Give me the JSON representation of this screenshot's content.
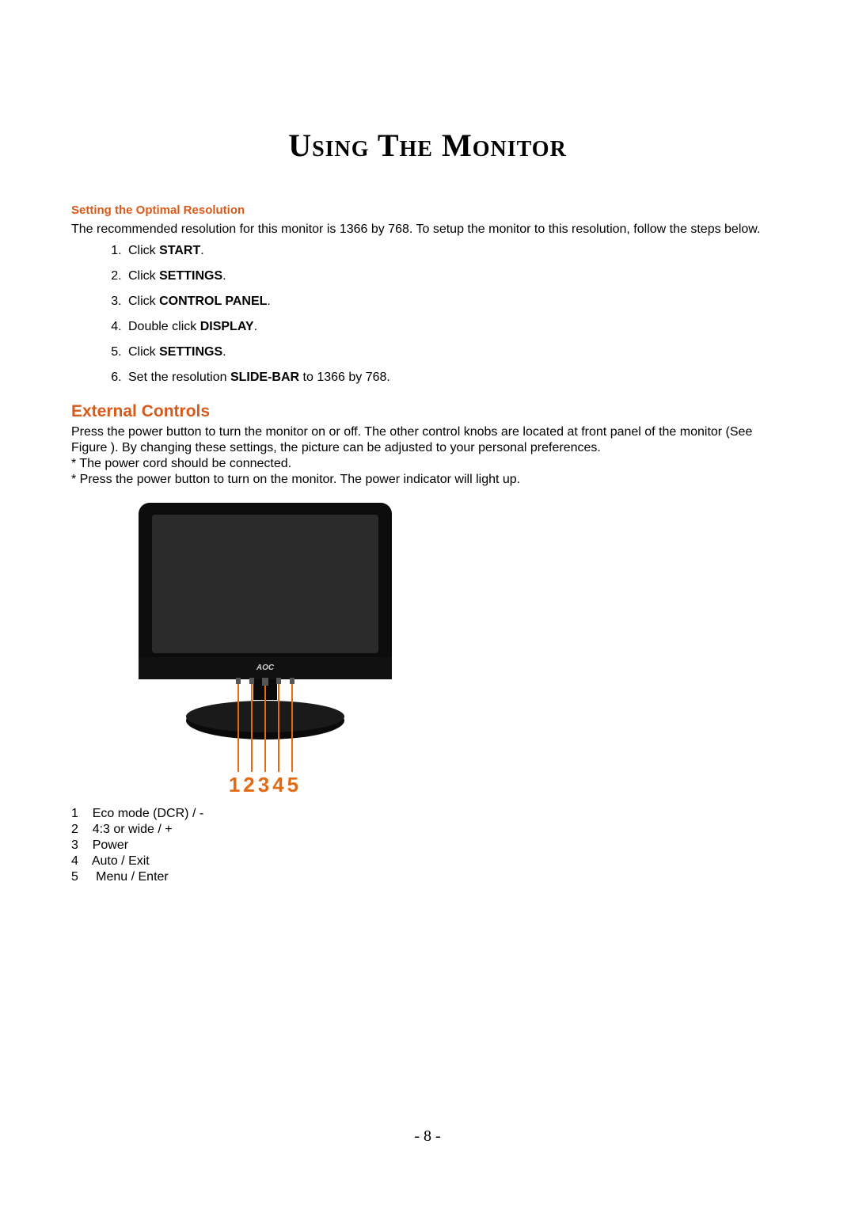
{
  "title": "Using The Monitor",
  "section1": {
    "heading": "Setting the Optimal Resolution",
    "intro": "The recommended resolution for this monitor is 1366 by 768. To setup the monitor to this resolution, follow the steps below.",
    "steps": [
      {
        "pre": "Click ",
        "bold": "START",
        "post": "."
      },
      {
        "pre": "Click ",
        "bold": "SETTINGS",
        "post": "."
      },
      {
        "pre": "Click ",
        "bold": "CONTROL PANEL",
        "post": "."
      },
      {
        "pre": "Double click ",
        "bold": "DISPLAY",
        "post": "."
      },
      {
        "pre": "Click ",
        "bold": "SETTINGS",
        "post": "."
      },
      {
        "pre": "Set the resolution ",
        "bold": "SLIDE-BAR",
        "post": " to 1366 by 768."
      }
    ]
  },
  "section2": {
    "heading": "External Controls",
    "para": "Press the power button to turn the monitor on or off. The other control knobs are located at front panel of the monitor (See Figure ). By changing these settings, the picture can be adjusted to your personal preferences.",
    "note1": "* The power cord should be connected.",
    "note2": "* Press the power button to turn on the monitor. The power indicator will light up."
  },
  "figure": {
    "brand": "AOC",
    "labels": "12345"
  },
  "legend": [
    {
      "n": "1",
      "t": "Eco mode (DCR) / -"
    },
    {
      "n": "2",
      "t": "4:3 or wide / +"
    },
    {
      "n": "3",
      "t": "Power"
    },
    {
      "n": "4",
      "t": "Auto / Exit"
    },
    {
      "n": "5",
      "t": " Menu / Enter"
    }
  ],
  "pageNumber": "- 8 -"
}
